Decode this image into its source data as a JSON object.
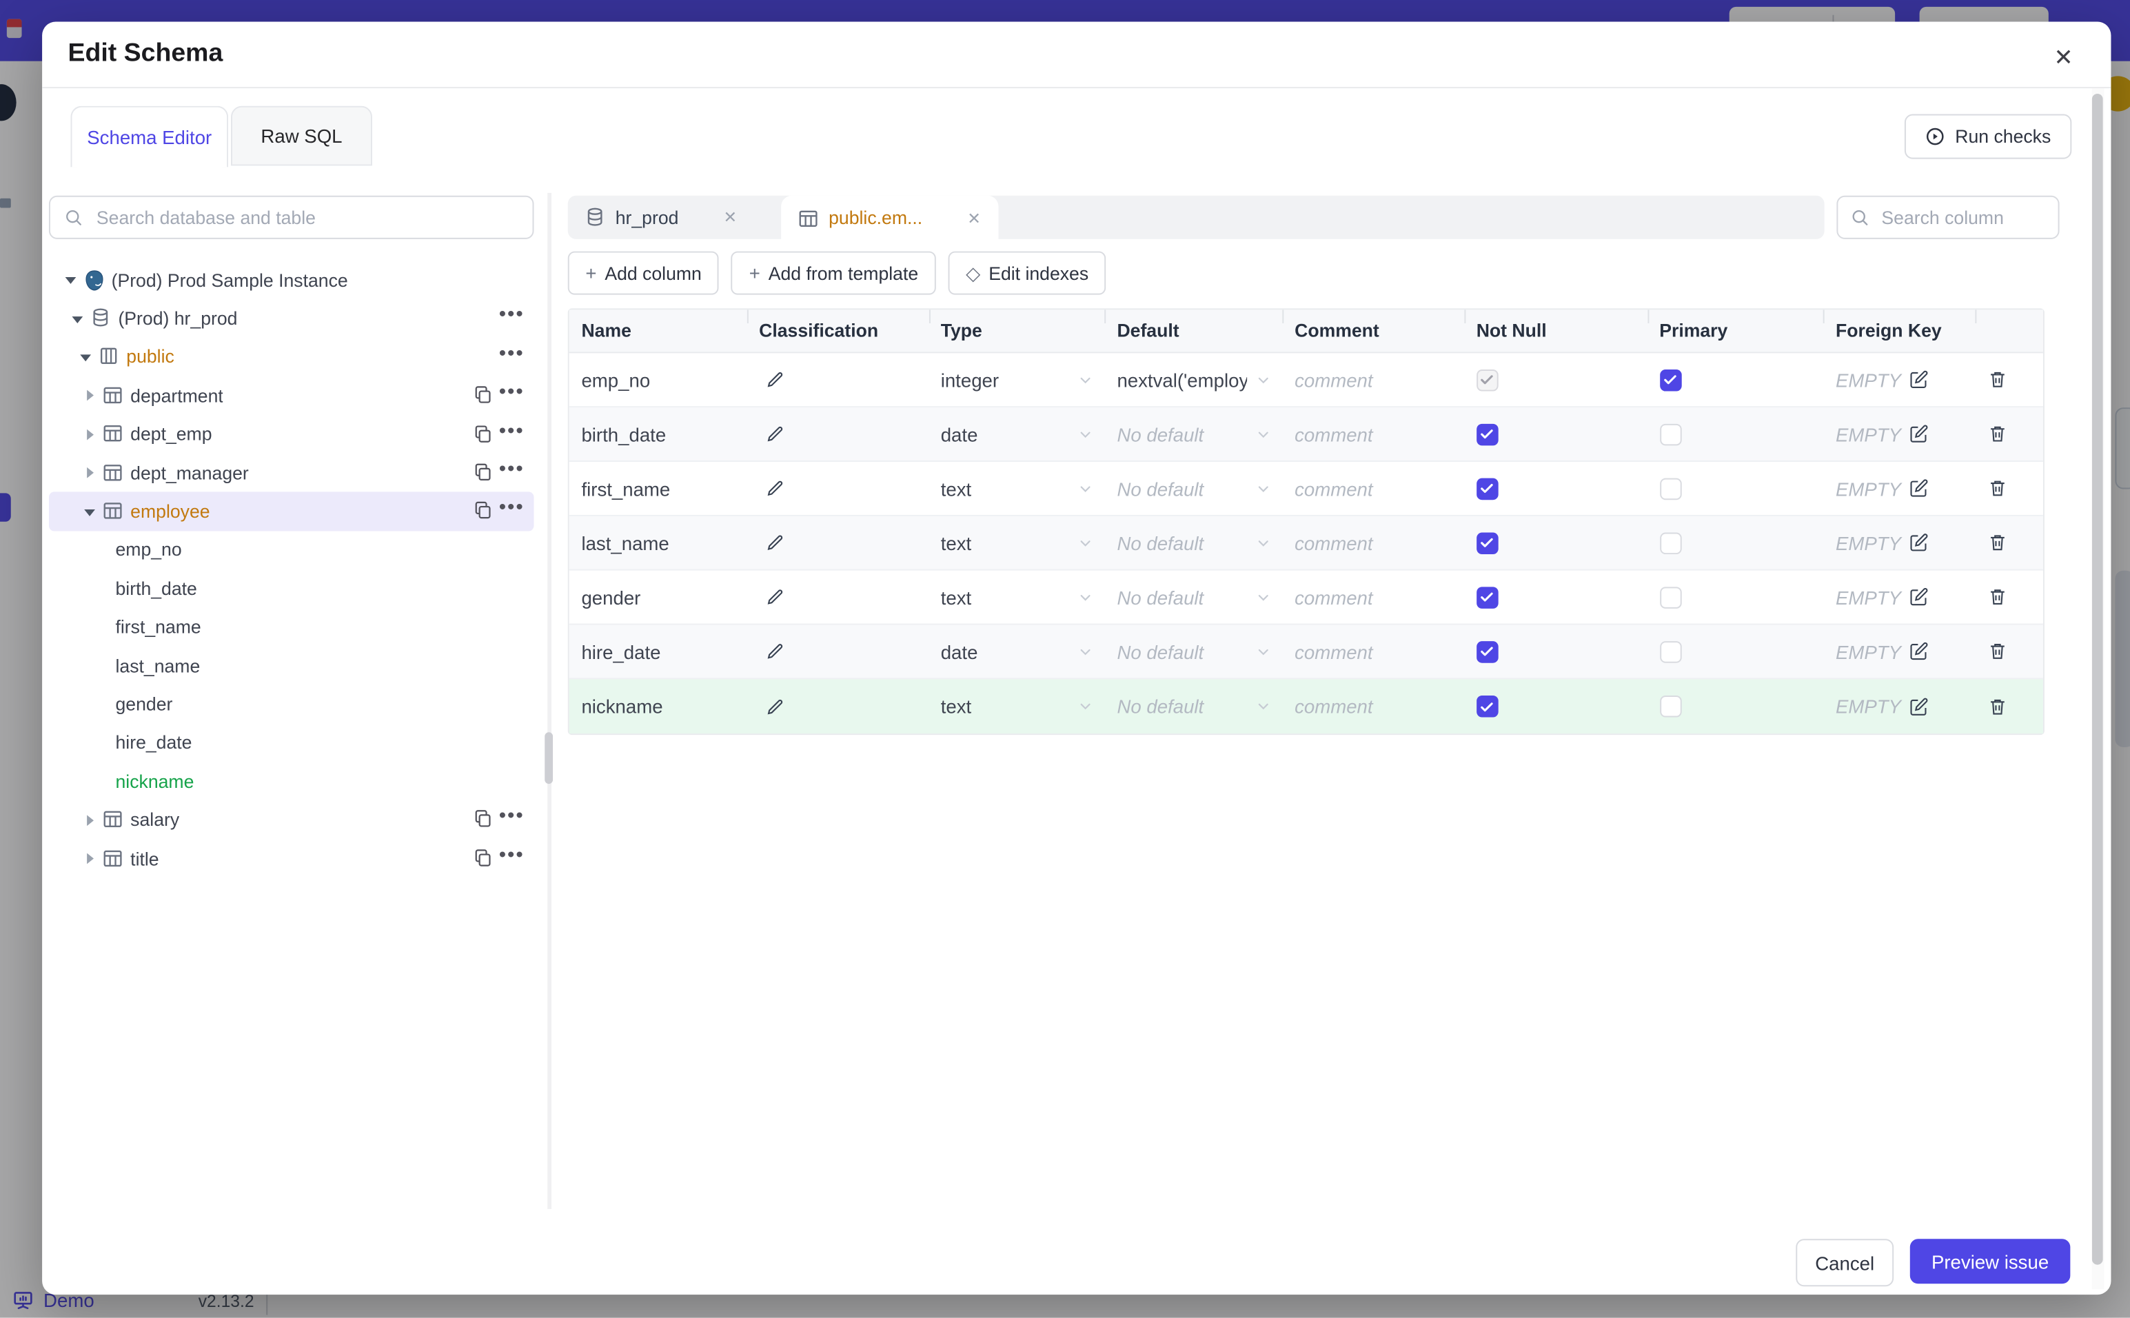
{
  "underlying_page": {
    "demo_label": "Demo",
    "version": "v2.13.2"
  },
  "modal": {
    "title": "Edit Schema",
    "tabs": [
      {
        "label": "Schema Editor",
        "active": true
      },
      {
        "label": "Raw SQL",
        "active": false
      }
    ],
    "run_checks_label": "Run checks",
    "footer": {
      "cancel_label": "Cancel",
      "preview_label": "Preview issue"
    }
  },
  "sidebar": {
    "search_placeholder": "Search database and table",
    "tree": [
      {
        "label": "(Prod) Prod Sample Instance",
        "level": 0,
        "icon": "postgres",
        "caret": "down"
      },
      {
        "label": "(Prod) hr_prod",
        "level": 1,
        "icon": "database",
        "caret": "down",
        "ellipsis": true
      },
      {
        "label": "public",
        "level": 2,
        "icon": "schema",
        "caret": "down",
        "ellipsis": true,
        "color": "orange"
      },
      {
        "label": "department",
        "level": 3,
        "icon": "table",
        "caret": "right",
        "copy": true,
        "ellipsis": true
      },
      {
        "label": "dept_emp",
        "level": 3,
        "icon": "table",
        "caret": "right",
        "copy": true,
        "ellipsis": true
      },
      {
        "label": "dept_manager",
        "level": 3,
        "icon": "table",
        "caret": "right",
        "copy": true,
        "ellipsis": true
      },
      {
        "label": "employee",
        "level": 3,
        "icon": "table",
        "caret": "down",
        "copy": true,
        "ellipsis": true,
        "color": "orange",
        "selected": true
      },
      {
        "label": "emp_no",
        "level": 4,
        "column": true
      },
      {
        "label": "birth_date",
        "level": 4,
        "column": true
      },
      {
        "label": "first_name",
        "level": 4,
        "column": true
      },
      {
        "label": "last_name",
        "level": 4,
        "column": true
      },
      {
        "label": "gender",
        "level": 4,
        "column": true
      },
      {
        "label": "hire_date",
        "level": 4,
        "column": true
      },
      {
        "label": "nickname",
        "level": 4,
        "column": true,
        "color": "green"
      },
      {
        "label": "salary",
        "level": 3,
        "icon": "table",
        "caret": "right",
        "copy": true,
        "ellipsis": true
      },
      {
        "label": "title",
        "level": 3,
        "icon": "table",
        "caret": "right",
        "copy": true,
        "ellipsis": true
      }
    ]
  },
  "editor": {
    "tabs": [
      {
        "label": "hr_prod",
        "icon": "database-icon",
        "active": false
      },
      {
        "label": "public.em...",
        "icon": "table-icon",
        "active": true
      }
    ],
    "column_search_placeholder": "Search column",
    "toolbar": [
      {
        "label": "Add column",
        "icon": "plus-icon"
      },
      {
        "label": "Add from template",
        "icon": "plus-icon"
      },
      {
        "label": "Edit indexes",
        "icon": "diamond-icon"
      }
    ],
    "table": {
      "headers": [
        "Name",
        "Classification",
        "Type",
        "Default",
        "Comment",
        "Not Null",
        "Primary",
        "Foreign Key",
        ""
      ],
      "comment_placeholder": "comment",
      "no_default_label": "No default",
      "foreign_key_empty": "EMPTY",
      "rows": [
        {
          "name": "emp_no",
          "type": "integer",
          "default": "nextval('employ",
          "has_default": true,
          "not_null": "checked_disabled",
          "primary": "checked",
          "highlight": false
        },
        {
          "name": "birth_date",
          "type": "date",
          "default": "No default",
          "has_default": false,
          "not_null": "checked",
          "primary": "unchecked",
          "highlight": false
        },
        {
          "name": "first_name",
          "type": "text",
          "default": "No default",
          "has_default": false,
          "not_null": "checked",
          "primary": "unchecked",
          "highlight": false
        },
        {
          "name": "last_name",
          "type": "text",
          "default": "No default",
          "has_default": false,
          "not_null": "checked",
          "primary": "unchecked",
          "highlight": false
        },
        {
          "name": "gender",
          "type": "text",
          "default": "No default",
          "has_default": false,
          "not_null": "checked",
          "primary": "unchecked",
          "highlight": false
        },
        {
          "name": "hire_date",
          "type": "date",
          "default": "No default",
          "has_default": false,
          "not_null": "checked",
          "primary": "unchecked",
          "highlight": false
        },
        {
          "name": "nickname",
          "type": "text",
          "default": "No default",
          "has_default": false,
          "not_null": "checked",
          "primary": "unchecked",
          "highlight": true
        }
      ]
    }
  }
}
